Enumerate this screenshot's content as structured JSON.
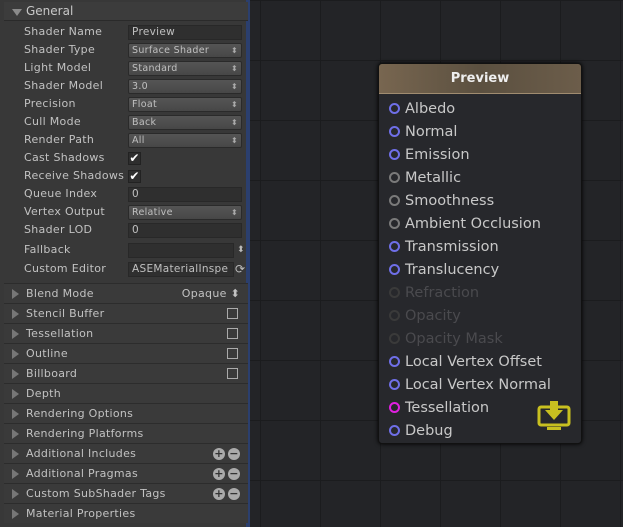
{
  "general": {
    "title": "General",
    "rows": [
      {
        "label": "Shader Name",
        "value": "Preview",
        "kind": "text"
      },
      {
        "label": "Shader Type",
        "value": "Surface Shader",
        "kind": "dropdown"
      },
      {
        "label": "Light Model",
        "value": "Standard",
        "kind": "dropdown"
      },
      {
        "label": "Shader Model",
        "value": "3.0",
        "kind": "dropdown"
      },
      {
        "label": "Precision",
        "value": "Float",
        "kind": "dropdown"
      },
      {
        "label": "Cull Mode",
        "value": "Back",
        "kind": "dropdown"
      },
      {
        "label": "Render Path",
        "value": "All",
        "kind": "dropdown"
      },
      {
        "label": "Cast Shadows",
        "checked": true,
        "kind": "check"
      },
      {
        "label": "Receive Shadows",
        "checked": true,
        "kind": "check"
      },
      {
        "label": "Queue Index",
        "value": "0",
        "kind": "text"
      },
      {
        "label": "Vertex Output",
        "value": "Relative",
        "kind": "dropdown"
      },
      {
        "label": "Shader LOD",
        "value": "0",
        "kind": "text"
      },
      {
        "label": "Fallback",
        "value": "",
        "kind": "text"
      },
      {
        "label": "Custom Editor",
        "value": "ASEMaterialInspe",
        "kind": "text"
      }
    ]
  },
  "sections": [
    {
      "label": "Blend Mode",
      "value": "Opaque"
    },
    {
      "label": "Stencil Buffer",
      "checkbox": false
    },
    {
      "label": "Tessellation",
      "checkbox": false
    },
    {
      "label": "Outline",
      "checkbox": false
    },
    {
      "label": "Billboard",
      "checkbox": false
    },
    {
      "label": "Depth"
    },
    {
      "label": "Rendering Options"
    },
    {
      "label": "Rendering Platforms"
    },
    {
      "label": "Additional Includes",
      "plusminus": true
    },
    {
      "label": "Additional Pragmas",
      "plusminus": true
    },
    {
      "label": "Custom SubShader Tags",
      "plusminus": true
    },
    {
      "label": "Material Properties"
    }
  ],
  "node": {
    "title": "Preview",
    "ports": [
      {
        "label": "Albedo",
        "color": "#6f6fe8",
        "enabled": true
      },
      {
        "label": "Normal",
        "color": "#6f6fe8",
        "enabled": true
      },
      {
        "label": "Emission",
        "color": "#6f6fe8",
        "enabled": true
      },
      {
        "label": "Metallic",
        "color": "#7a7a7a",
        "enabled": true
      },
      {
        "label": "Smoothness",
        "color": "#7a7a7a",
        "enabled": true
      },
      {
        "label": "Ambient Occlusion",
        "color": "#7a7a7a",
        "enabled": true
      },
      {
        "label": "Transmission",
        "color": "#6f6fe8",
        "enabled": true
      },
      {
        "label": "Translucency",
        "color": "#6f6fe8",
        "enabled": true
      },
      {
        "label": "Refraction",
        "color": "#3a3a3a",
        "enabled": false
      },
      {
        "label": "Opacity",
        "color": "#3a3a3a",
        "enabled": false
      },
      {
        "label": "Opacity Mask",
        "color": "#3a3a3a",
        "enabled": false
      },
      {
        "label": "Local Vertex Offset",
        "color": "#6f6fe8",
        "enabled": true
      },
      {
        "label": "Local Vertex Normal",
        "color": "#6f6fe8",
        "enabled": true
      },
      {
        "label": "Tessellation",
        "color": "#e020e0",
        "enabled": true
      },
      {
        "label": "Debug",
        "color": "#6f6fe8",
        "enabled": true
      }
    ],
    "master_icon": "download-monitor-icon",
    "master_icon_color": "#c8c020"
  }
}
